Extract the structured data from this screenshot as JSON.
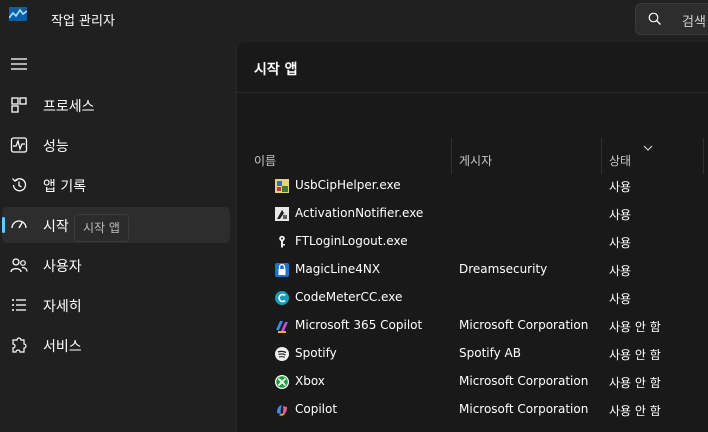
{
  "app": {
    "title": "작업 관리자"
  },
  "search": {
    "placeholder": "검색"
  },
  "sidebar": {
    "items": [
      {
        "label": "프로세스"
      },
      {
        "label": "성능"
      },
      {
        "label": "앱 기록"
      },
      {
        "label": "시작 앱"
      },
      {
        "label": "사용자"
      },
      {
        "label": "자세히"
      },
      {
        "label": "서비스"
      }
    ],
    "tooltip": "시작 앱"
  },
  "main": {
    "title": "시작 앱",
    "columns": {
      "name": "이름",
      "publisher": "게시자",
      "status": "상태"
    },
    "rows": [
      {
        "name": "UsbCipHelper.exe",
        "publisher": "",
        "status": "사용"
      },
      {
        "name": "ActivationNotifier.exe",
        "publisher": "",
        "status": "사용"
      },
      {
        "name": "FTLoginLogout.exe",
        "publisher": "",
        "status": "사용"
      },
      {
        "name": "MagicLine4NX",
        "publisher": "Dreamsecurity",
        "status": "사용"
      },
      {
        "name": "CodeMeterCC.exe",
        "publisher": "",
        "status": "사용"
      },
      {
        "name": "Microsoft 365 Copilot",
        "publisher": "Microsoft Corporation",
        "status": "사용 안 함"
      },
      {
        "name": "Spotify",
        "publisher": "Spotify AB",
        "status": "사용 안 함"
      },
      {
        "name": "Xbox",
        "publisher": "Microsoft Corporation",
        "status": "사용 안 함"
      },
      {
        "name": "Copilot",
        "publisher": "Microsoft Corporation",
        "status": "사용 안 함"
      }
    ]
  },
  "colors": {
    "accent": "#60cdff",
    "background": "#202020",
    "content_background": "#191919"
  }
}
